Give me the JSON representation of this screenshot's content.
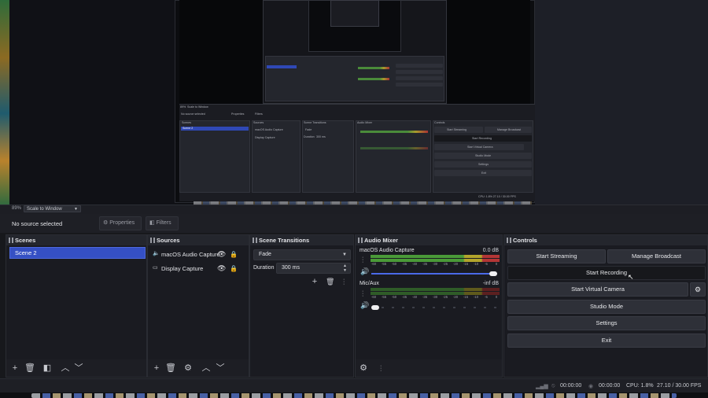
{
  "preview": {
    "nested_obs": {
      "zoom": "89%",
      "scale_label": "Scale to Window",
      "no_source": "No source selected",
      "properties": "Properties",
      "filters": "Filters",
      "scenes": "Scenes",
      "scene_item": "Scene 2",
      "sources": "Sources",
      "source_1": "macOS Audio Capture",
      "source_2": "Display Capture",
      "transitions": "Scene Transitions",
      "fade": "Fade",
      "duration": "Duration",
      "duration_value": "300 ms",
      "mixer": "Audio Mixer",
      "controls": "Controls",
      "start_streaming": "Start Streaming",
      "manage_broadcast": "Manage Broadcast",
      "start_recording": "Start Recording",
      "start_virtual": "Start Virtual Camera",
      "studio_mode": "Studio Mode",
      "settings": "Settings",
      "exit": "Exit",
      "status": "CPU: 1.8%     27.10 / 30.00 FPS"
    }
  },
  "strip": {
    "zoom": "89%",
    "scale_select": "Scale to Window"
  },
  "toolbar": {
    "no_source": "No source selected",
    "properties_label": "Properties",
    "filters_label": "Filters"
  },
  "scenes": {
    "title": "Scenes",
    "items": [
      {
        "label": "Scene 2",
        "selected": true
      }
    ]
  },
  "sources": {
    "title": "Sources",
    "items": [
      {
        "label": "macOS Audio Capture",
        "icon": "speaker-icon",
        "visible": true,
        "locked": true
      },
      {
        "label": "Display Capture",
        "icon": "monitor-icon",
        "visible": true,
        "locked": true
      }
    ]
  },
  "transitions": {
    "title": "Scene Transitions",
    "transition_value": "Fade",
    "duration_label": "Duration",
    "duration_value": "300 ms"
  },
  "mixer": {
    "title": "Audio Mixer",
    "channels": [
      {
        "name": "macOS Audio Capture",
        "level": "0.0 dB",
        "volume_fraction": 1.0
      },
      {
        "name": "Mic/Aux",
        "level": "-inf dB",
        "volume_fraction": 0.0
      }
    ],
    "ticks": [
      "-60",
      "-55",
      "-50",
      "-45",
      "-40",
      "-35",
      "-30",
      "-25",
      "-20",
      "-15",
      "-10",
      "-5",
      "0"
    ]
  },
  "controls": {
    "title": "Controls",
    "start_streaming": "Start Streaming",
    "manage_broadcast": "Manage Broadcast",
    "start_recording": "Start Recording",
    "start_virtual_camera": "Start Virtual Camera",
    "studio_mode": "Studio Mode",
    "settings": "Settings",
    "exit": "Exit"
  },
  "status": {
    "stream_time": "00:00:00",
    "record_time": "00:00:00",
    "cpu": "CPU: 1.8%",
    "fps": "27.10 / 30.00 FPS"
  },
  "colors": {
    "accent": "#3550c4",
    "panel": "#1a1b21",
    "header": "#24262d",
    "meter_green": "#4a9a38",
    "meter_yellow": "#b3a52c",
    "meter_red": "#b43636"
  }
}
